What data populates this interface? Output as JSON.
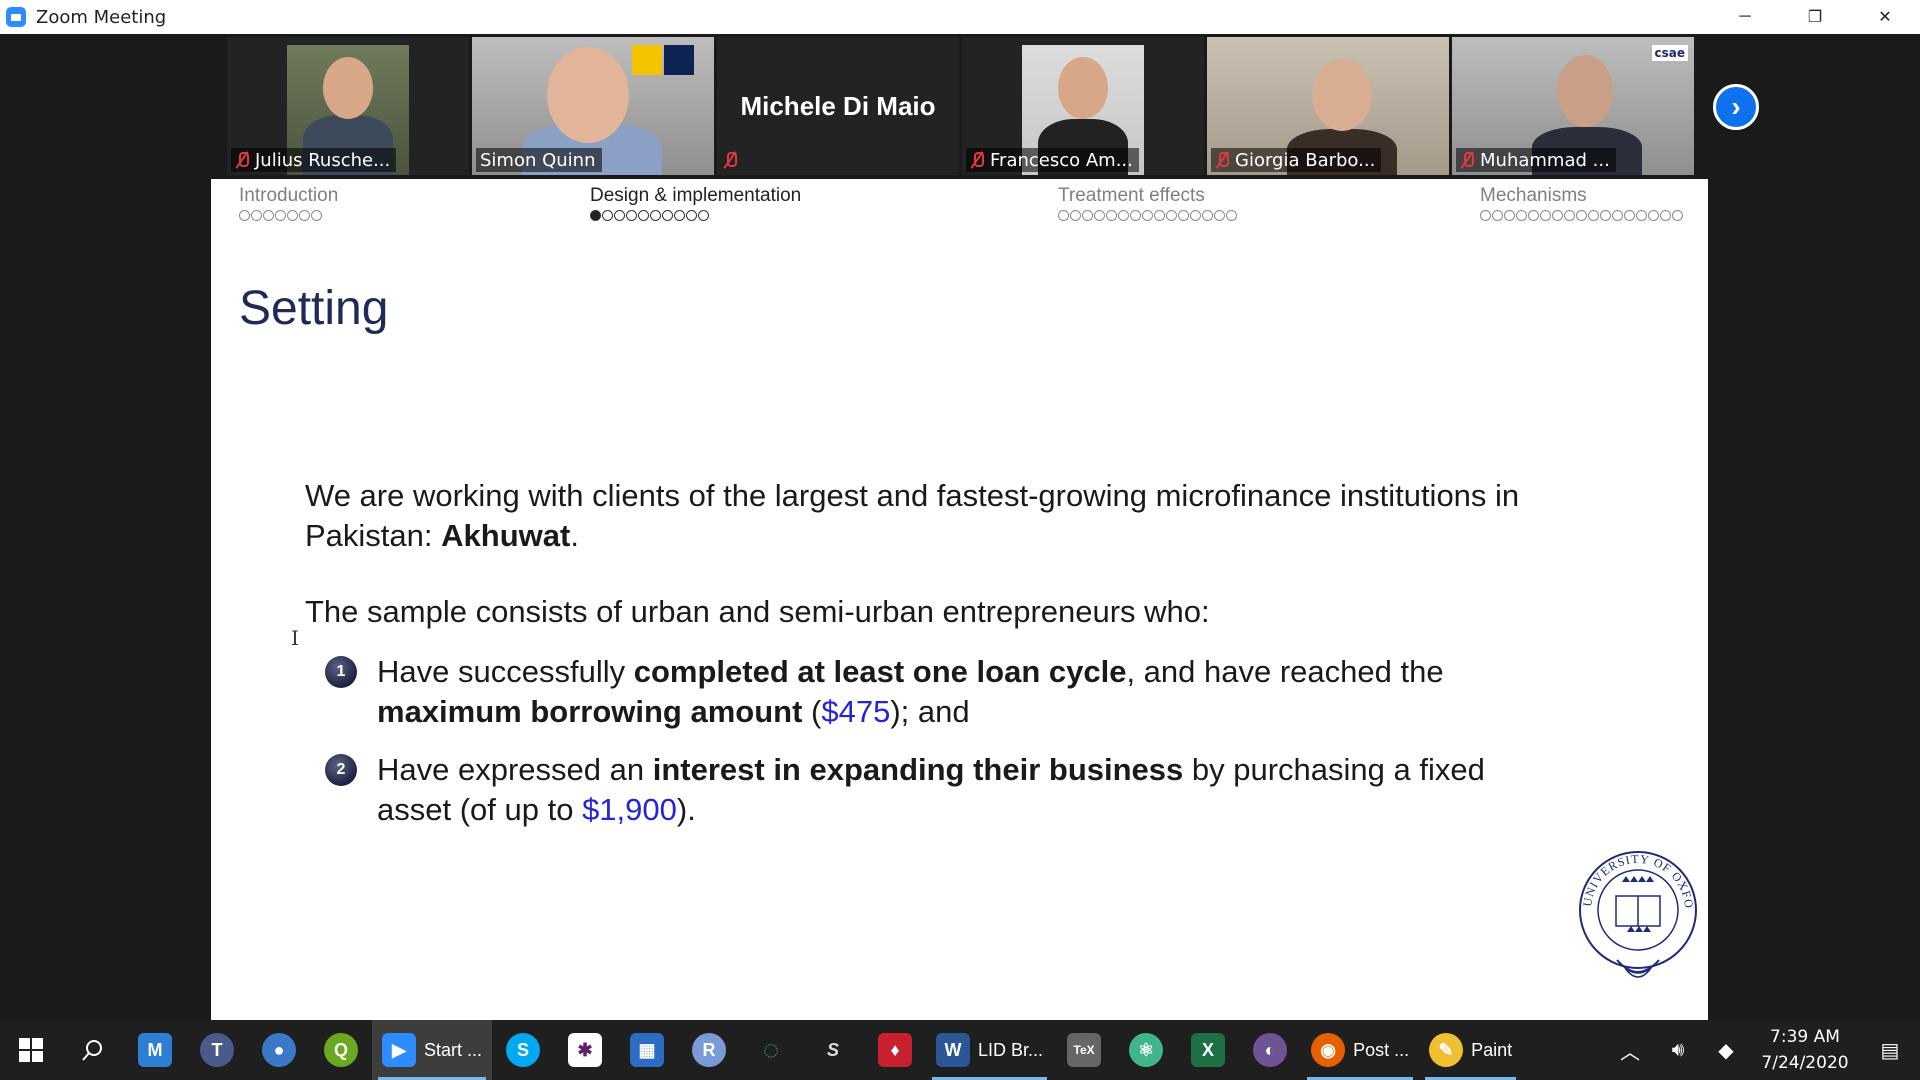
{
  "window": {
    "title": "Zoom Meeting",
    "controls": {
      "minimize": "─",
      "restore": "❐",
      "close": "✕"
    }
  },
  "participants": [
    {
      "name": "Julius Rusche...",
      "muted": true
    },
    {
      "name": "Simon Quinn",
      "muted": false,
      "speaking": true
    },
    {
      "name": "Michele Di Maio",
      "muted": true,
      "video": false
    },
    {
      "name": "Francesco Am...",
      "muted": true
    },
    {
      "name": "Giorgia Barbo...",
      "muted": true
    },
    {
      "name": "Muhammad ...",
      "muted": true,
      "badge": "csae"
    }
  ],
  "next_page_icon": "chevron-right-icon",
  "slide": {
    "sections": [
      {
        "label": "Introduction",
        "dots": 7,
        "filled": 0,
        "current": false
      },
      {
        "label": "Design & implementation",
        "dots": 10,
        "filled": 1,
        "current": true
      },
      {
        "label": "Treatment effects",
        "dots": 15,
        "filled": 0,
        "current": false
      },
      {
        "label": "Mechanisms",
        "dots": 17,
        "filled": 0,
        "current": false
      }
    ],
    "title": "Setting",
    "para1": {
      "line1": "We are working with clients of the largest and fastest-growing microfinance institutions in",
      "line2_pre": "Pakistan: ",
      "line2_bold": "Akhuwat",
      "line2_post": "."
    },
    "para2": "The sample consists of urban and semi-urban entrepreneurs who:",
    "items": [
      {
        "num": "1",
        "t1": "Have successfully ",
        "b1": "completed at least one loan cycle",
        "t2": ", and have reached the",
        "b2": "maximum borrowing amount",
        "t3": " (",
        "amount": "$475",
        "t4": "); and"
      },
      {
        "num": "2",
        "t1": "Have expressed an ",
        "b1": "interest in expanding their business",
        "t2": " by purchasing a fixed",
        "t3": "asset (of up to ",
        "amount": "$1,900",
        "t4": ")."
      }
    ],
    "seal_text": "UNIVERSITY OF OXFORD"
  },
  "taskbar": {
    "apps": [
      {
        "icon": "start-icon"
      },
      {
        "icon": "search-icon"
      },
      {
        "icon": "app-icon-m",
        "glyph": "M",
        "color": "#2d7fd6"
      },
      {
        "icon": "texstudio-icon",
        "glyph": "T",
        "color": "#4a5a8a"
      },
      {
        "icon": "earth-icon",
        "glyph": "●",
        "color": "#3a78c8"
      },
      {
        "icon": "qgis-icon",
        "glyph": "Q",
        "color": "#6aa822"
      },
      {
        "icon": "zoom-icon",
        "label": "Start ...",
        "color": "#2d8cff",
        "active": true
      },
      {
        "icon": "skype-icon",
        "glyph": "S",
        "color": "#00a9f0"
      },
      {
        "icon": "slack-icon",
        "glyph": "✱",
        "color": "#611f69"
      },
      {
        "icon": "calendar-icon",
        "glyph": "▦",
        "color": "#2b6cc4"
      },
      {
        "icon": "r-icon",
        "glyph": "R",
        "color": "#7a9cd6"
      },
      {
        "icon": "refresh-icon",
        "glyph": "◌",
        "color": "#1a9e3f"
      },
      {
        "icon": "stata-icon",
        "glyph": "S",
        "color": "#555"
      },
      {
        "icon": "mendeley-icon",
        "glyph": "♦",
        "color": "#c8202f"
      },
      {
        "icon": "word-icon",
        "label": "LID Br...",
        "color": "#2b5797"
      },
      {
        "icon": "tex-icon",
        "glyph": "TeX",
        "color": "#666"
      },
      {
        "icon": "atom-icon",
        "glyph": "⚛",
        "color": "#40b58a"
      },
      {
        "icon": "excel-icon",
        "glyph": "X",
        "color": "#1e7145"
      },
      {
        "icon": "github-icon",
        "glyph": "◐",
        "color": "#6e5494"
      },
      {
        "icon": "firefox-icon",
        "label": "Post ...",
        "color": "#e66000"
      },
      {
        "icon": "paint-icon",
        "label": "Paint",
        "color": "#f0c030"
      }
    ],
    "tray": {
      "time": "7:39 AM",
      "date": "7/24/2020"
    }
  }
}
